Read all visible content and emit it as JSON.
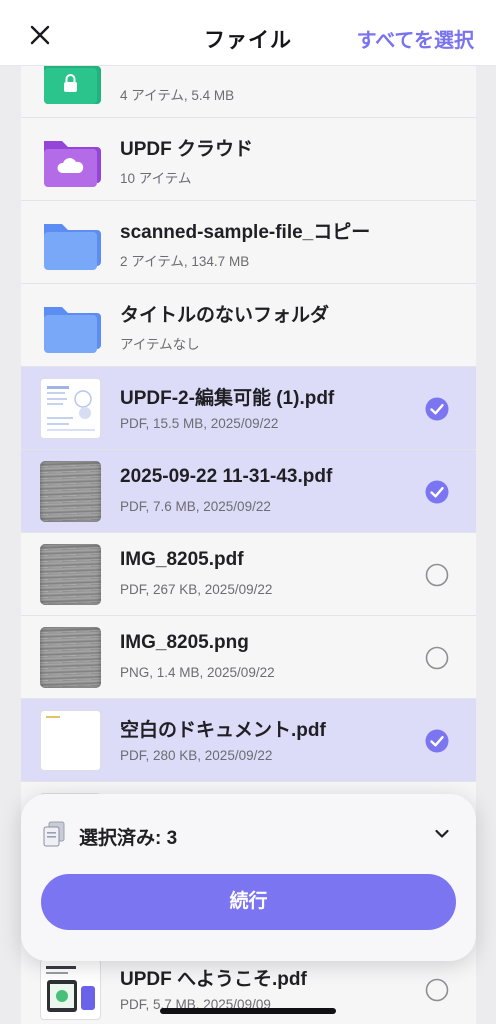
{
  "header": {
    "title": "ファイル",
    "select_all": "すべてを選択"
  },
  "files": [
    {
      "title": "",
      "meta": "4 アイテム, 5.4 MB",
      "icon": "lock-folder-icon",
      "selected": false
    },
    {
      "title": "UPDF クラウド",
      "meta": "10 アイテム",
      "icon": "cloud-folder-icon",
      "selected": false
    },
    {
      "title": "scanned-sample-file_コピー",
      "meta": "2 アイテム, 134.7 MB",
      "icon": "folder-icon",
      "selected": false
    },
    {
      "title": "タイトルのないフォルダ",
      "meta": "アイテムなし",
      "icon": "folder-icon",
      "selected": false
    },
    {
      "title": "UPDF-2-編集可能 (1).pdf",
      "meta": "PDF, 15.5 MB, 2025/09/22",
      "icon": "pdf-thumbnail",
      "selected": true
    },
    {
      "title": "2025-09-22 11-31-43.pdf",
      "meta": "PDF, 7.6 MB, 2025/09/22",
      "icon": "scan-thumbnail",
      "selected": true
    },
    {
      "title": "IMG_8205.pdf",
      "meta": "PDF, 267 KB, 2025/09/22",
      "icon": "scan-thumbnail",
      "selected": false
    },
    {
      "title": "IMG_8205.png",
      "meta": "PNG, 1.4 MB, 2025/09/22",
      "icon": "scan-thumbnail",
      "selected": false
    },
    {
      "title": "空白のドキュメント.pdf",
      "meta": "PDF, 280 KB, 2025/09/22",
      "icon": "blank-thumbnail",
      "selected": true
    },
    {
      "title": "UPDF へようこそ.pdf",
      "meta": "PDF, 5.7 MB, 2025/09/09",
      "icon": "pdf-thumbnail",
      "selected": false
    }
  ],
  "sheet": {
    "selected_label": "選択済み: 3",
    "continue_label": "続行"
  },
  "colors": {
    "accent": "#7c75f2",
    "selected_row": "#dcdcf8",
    "folder_blue": "#6c9cf6",
    "folder_purple": "#a55de0",
    "folder_green": "#20b37e"
  }
}
